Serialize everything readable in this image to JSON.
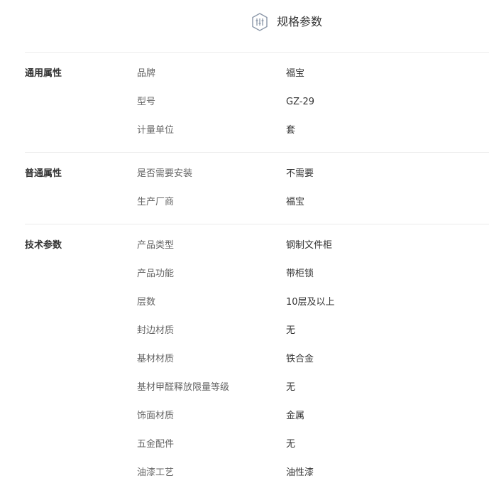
{
  "header": {
    "title": "规格参数",
    "icon": "sliders-icon",
    "icon_color": "#8a96a8"
  },
  "groups": [
    {
      "title": "通用属性",
      "rows": [
        {
          "name": "品牌",
          "value": "福宝"
        },
        {
          "name": "型号",
          "value": "GZ-29"
        },
        {
          "name": "计量单位",
          "value": "套"
        }
      ]
    },
    {
      "title": "普通属性",
      "rows": [
        {
          "name": "是否需要安装",
          "value": "不需要"
        },
        {
          "name": "生产厂商",
          "value": "福宝"
        }
      ]
    },
    {
      "title": "技术参数",
      "rows": [
        {
          "name": "产品类型",
          "value": "钢制文件柜"
        },
        {
          "name": "产品功能",
          "value": "带柜锁"
        },
        {
          "name": "层数",
          "value": "10层及以上"
        },
        {
          "name": "封边材质",
          "value": "无"
        },
        {
          "name": "基材材质",
          "value": "铁合金"
        },
        {
          "name": "基材甲醛释放限量等级",
          "value": "无"
        },
        {
          "name": "饰面材质",
          "value": "金属"
        },
        {
          "name": "五金配件",
          "value": "无"
        },
        {
          "name": "油漆工艺",
          "value": "油性漆"
        }
      ]
    }
  ]
}
